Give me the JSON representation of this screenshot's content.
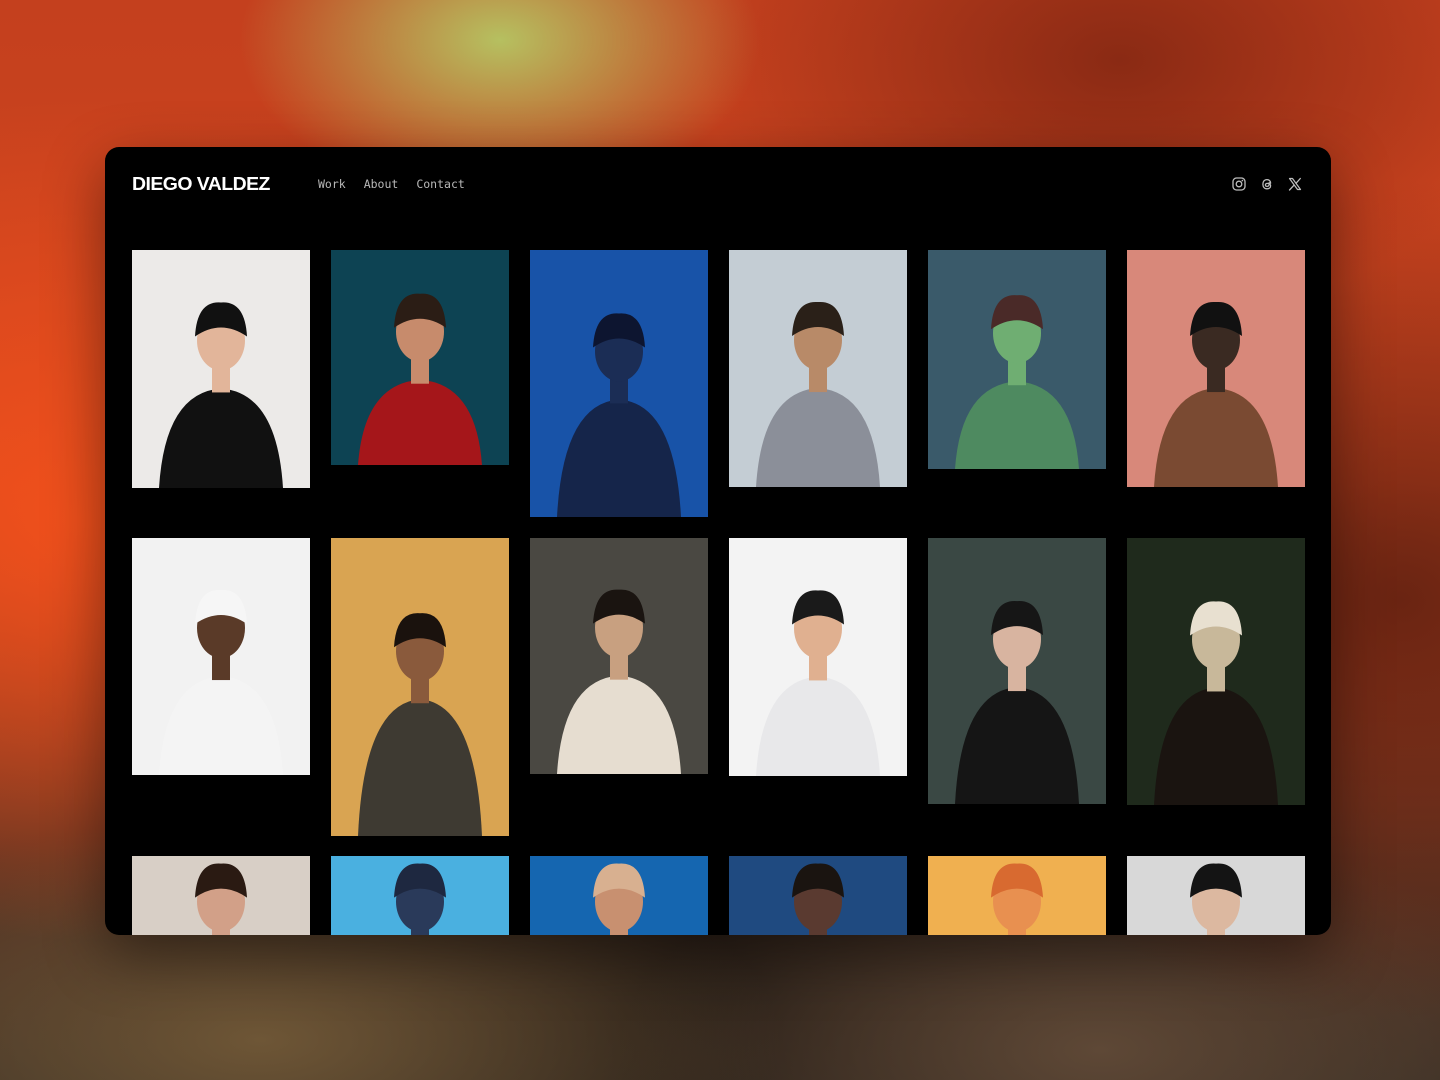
{
  "header": {
    "logo": "DIEGO VALDEZ",
    "nav": [
      "Work",
      "About",
      "Contact"
    ],
    "social_icons": [
      "instagram-icon",
      "threads-icon",
      "x-icon"
    ]
  },
  "colors": {
    "window_bg": "#000000",
    "logo": "#ffffff",
    "nav_text": "#b8b8b8"
  },
  "gallery": [
    {
      "name": "portrait-woman-white-orchid",
      "bg": "#eceae8",
      "skin": "#e2b59a",
      "hair": "#111111",
      "cloth": "#111111"
    },
    {
      "name": "portrait-man-red-jacket-teal",
      "bg": "#0d4353",
      "skin": "#c78b6c",
      "hair": "#2b1d15",
      "cloth": "#a5161a"
    },
    {
      "name": "portrait-woman-blue-light",
      "bg": "#1853a8",
      "skin": "#1b2d55",
      "hair": "#0d1530",
      "cloth": "#15254a"
    },
    {
      "name": "model-striped-shirt-red-pants",
      "bg": "#c4cdd4",
      "skin": "#b88a68",
      "hair": "#2a2018",
      "cloth": "#8b8f99"
    },
    {
      "name": "portrait-green-underwater",
      "bg": "#3a5a6a",
      "skin": "#6fae72",
      "hair": "#4a2a28",
      "cloth": "#4e8a60"
    },
    {
      "name": "model-brown-coat-pink-wall",
      "bg": "#d8887a",
      "skin": "#3a2a22",
      "hair": "#111111",
      "cloth": "#7a4a32"
    },
    {
      "name": "man-white-hoodie-beanie",
      "bg": "#f2f2f2",
      "skin": "#5a3a28",
      "hair": "#f6f6f6",
      "cloth": "#f4f4f4"
    },
    {
      "name": "man-dark-coat-yellow-arch",
      "bg": "#d9a452",
      "skin": "#8a5a3c",
      "hair": "#1a120d",
      "cloth": "#3e3a32"
    },
    {
      "name": "woman-white-cape-shadow",
      "bg": "#4a4842",
      "skin": "#c8a080",
      "hair": "#1a1410",
      "cloth": "#e6ddd0"
    },
    {
      "name": "man-wet-hair-white-jacket",
      "bg": "#f3f3f3",
      "skin": "#e0b090",
      "hair": "#1a1a1a",
      "cloth": "#e8e8ea"
    },
    {
      "name": "woman-black-feathers-crown",
      "bg": "#3a4844",
      "skin": "#d8b4a0",
      "hair": "#161616",
      "cloth": "#151515"
    },
    {
      "name": "woman-fur-chair-plants",
      "bg": "#1f2a1c",
      "skin": "#c8b89a",
      "hair": "#e8e0d0",
      "cloth": "#1a1410"
    },
    {
      "name": "portrait-woman-center-part",
      "bg": "#d8cfc6",
      "skin": "#d2a088",
      "hair": "#2a1a12",
      "cloth": "#c8b8a8"
    },
    {
      "name": "figure-hat-sky-blue",
      "bg": "#4ab0e0",
      "skin": "#2a3a5a",
      "hair": "#1e2840",
      "cloth": "#1e2840"
    },
    {
      "name": "man-red-jacket-blue-sky",
      "bg": "#1566b0",
      "skin": "#c89070",
      "hair": "#d8b090",
      "cloth": "#c0401c"
    },
    {
      "name": "woman-blue-dusk",
      "bg": "#1f4a80",
      "skin": "#5a3a30",
      "hair": "#1a1410",
      "cloth": "#1a2a44"
    },
    {
      "name": "woman-orange-hair-yellow",
      "bg": "#f0b050",
      "skin": "#e89050",
      "hair": "#d86a30",
      "cloth": "#3a2a20"
    },
    {
      "name": "portrait-woman-grey-bg",
      "bg": "#d8d8d8",
      "skin": "#dcb8a0",
      "hair": "#141414",
      "cloth": "#222222"
    }
  ]
}
